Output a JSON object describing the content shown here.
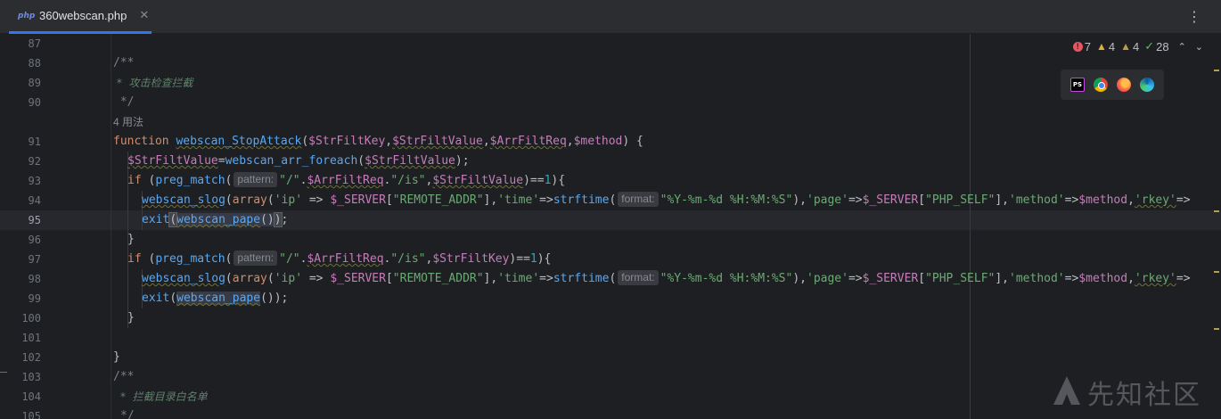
{
  "tab": {
    "icon": "php",
    "title": "360webscan.php",
    "close": "✕"
  },
  "menu": {
    "kebab": "⋮"
  },
  "inspections": {
    "errors": "7",
    "warnings": "4",
    "weak_warnings": "4",
    "typos": "28",
    "up": "^",
    "down": "v"
  },
  "browsers": [
    "phpstorm-icon",
    "chrome-icon",
    "firefox-icon",
    "edge-icon"
  ],
  "ps_label": "PS",
  "usage_hint": "4 用法",
  "line_numbers": [
    "87",
    "88",
    "89",
    "90",
    "91",
    "92",
    "93",
    "94",
    "95",
    "96",
    "97",
    "98",
    "99",
    "100",
    "101",
    "102",
    "103",
    "104",
    "105"
  ],
  "code": {
    "l88": "/**",
    "l89_star": " *  ",
    "l89_text": "攻击检查拦截",
    "l90": " */",
    "l91": {
      "kw": "function ",
      "fn": "webscan_StopAttack",
      "p1": "(",
      "v1": "$StrFiltKey",
      "c1": ",",
      "v2": "$StrFiltValue",
      "c2": ",",
      "v3": "$ArrFiltReq",
      "c3": ",",
      "v4": "$method",
      "p2": ") {"
    },
    "l92": {
      "v1": "$StrFiltValue",
      "op": "=",
      "fn": "webscan_arr_foreach",
      "p1": "(",
      "v2": "$StrFiltValue",
      "p2": ");"
    },
    "l93": {
      "kw": "if ",
      "p1": "(",
      "fn": "preg_match",
      "p2": "(",
      "hint": "pattern:",
      "s1": "\"/\"",
      "dot1": ".",
      "v1": "$ArrFiltReq",
      "dot2": ".",
      "s2": "\"/is\"",
      "c": ",",
      "v2": "$StrFiltValue",
      "p3": ")==",
      "n": "1",
      "p4": "){"
    },
    "l94": {
      "fn1": "webscan_slog",
      "p1": "(",
      "kw": "array",
      "p2": "(",
      "s1": "'ip'",
      "op1": " => ",
      "v1": "$_SERVER",
      "b1": "[",
      "s2": "\"REMOTE_ADDR\"",
      "b2": "],",
      "s3": "'time'",
      "op2": "=>",
      "fn2": "strftime",
      "p3": "(",
      "hint": "format:",
      "s4": "\"%Y-%m-%d %H:%M:%S\"",
      "p4": "),",
      "s5": "'page'",
      "op3": "=>",
      "v2": "$_SERVER",
      "b3": "[",
      "s6": "\"PHP_SELF\"",
      "b4": "],",
      "s7": "'method'",
      "op4": "=>",
      "v3": "$method",
      "c": ",",
      "s8": "'rkey'",
      "op5": "=>"
    },
    "l95": {
      "fn1": "exit",
      "p1": "(",
      "fn2": "webscan_pape",
      "p2": "()",
      "p3": ")",
      "p4": ";"
    },
    "l96": "}",
    "l97": {
      "kw": "if ",
      "p1": "(",
      "fn": "preg_match",
      "p2": "(",
      "hint": "pattern:",
      "s1": "\"/\"",
      "dot1": ".",
      "v1": "$ArrFiltReq",
      "dot2": ".",
      "s2": "\"/is\"",
      "c": ",",
      "v2": "$StrFiltKey",
      "p3": ")==",
      "n": "1",
      "p4": "){"
    },
    "l98": {
      "fn1": "webscan_slog",
      "p1": "(",
      "kw": "array",
      "p2": "(",
      "s1": "'ip'",
      "op1": " => ",
      "v1": "$_SERVER",
      "b1": "[",
      "s2": "\"REMOTE_ADDR\"",
      "b2": "],",
      "s3": "'time'",
      "op2": "=>",
      "fn2": "strftime",
      "p3": "(",
      "hint": "format:",
      "s4": "\"%Y-%m-%d %H:%M:%S\"",
      "p4": "),",
      "s5": "'page'",
      "op3": "=>",
      "v2": "$_SERVER",
      "b3": "[",
      "s6": "\"PHP_SELF\"",
      "b4": "],",
      "s7": "'method'",
      "op4": "=>",
      "v3": "$method",
      "c": ",",
      "s8": "'rkey'",
      "op5": "=>"
    },
    "l99": {
      "fn1": "exit",
      "p1": "(",
      "fn2": "webscan_pape",
      "p2": "());"
    },
    "l100": "}",
    "l102": "}",
    "l103": "/**",
    "l104_star": "*  ",
    "l104_text": "拦截目录白名单",
    "l105": "*/"
  },
  "watermark": "先知社区",
  "colors": {
    "accent": "#3574f0",
    "keyword": "#cf8e6d",
    "function": "#56a8f5",
    "variable": "#c77dbb",
    "string": "#6aab73",
    "number": "#2aacb8"
  }
}
